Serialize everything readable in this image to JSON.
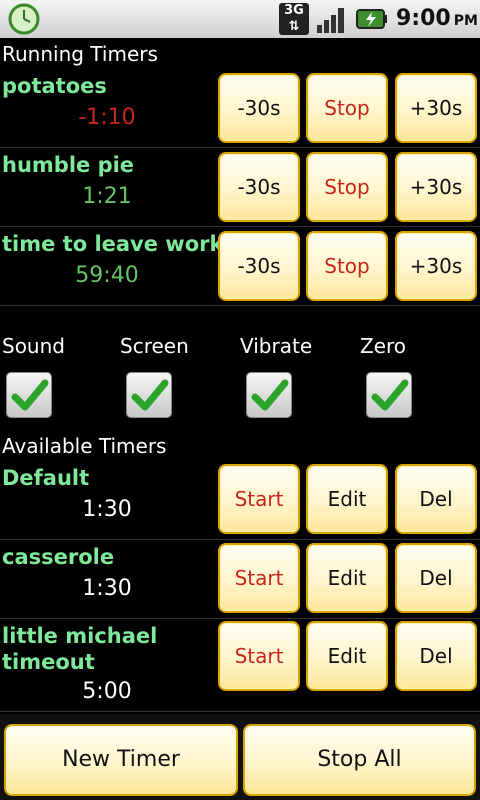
{
  "status_bar": {
    "network": "3G",
    "time": "9:00",
    "ampm": "PM"
  },
  "running": {
    "header": "Running Timers",
    "rows": [
      {
        "name": "potatoes",
        "time": "-1:10",
        "minus": "-30s",
        "stop": "Stop",
        "plus": "+30s"
      },
      {
        "name": "humble pie",
        "time": "1:21",
        "minus": "-30s",
        "stop": "Stop",
        "plus": "+30s"
      },
      {
        "name": "time to leave work",
        "time": "59:40",
        "minus": "-30s",
        "stop": "Stop",
        "plus": "+30s"
      }
    ]
  },
  "options": [
    {
      "label": "Sound",
      "checked": true
    },
    {
      "label": "Screen",
      "checked": true
    },
    {
      "label": "Vibrate",
      "checked": true
    },
    {
      "label": "Zero",
      "checked": true
    }
  ],
  "available": {
    "header": "Available Timers",
    "rows": [
      {
        "name": "Default",
        "time": "1:30",
        "start": "Start",
        "edit": "Edit",
        "del": "Del"
      },
      {
        "name": "casserole",
        "time": "1:30",
        "start": "Start",
        "edit": "Edit",
        "del": "Del"
      },
      {
        "name": "little michael timeout",
        "time": "5:00",
        "start": "Start",
        "edit": "Edit",
        "del": "Del"
      }
    ]
  },
  "footer": {
    "new_timer": "New Timer",
    "stop_all": "Stop All"
  },
  "colors": {
    "name_green": "#7fe89a",
    "time_red": "#c7251b",
    "time_green": "#66c266",
    "button_border": "#d9a300"
  }
}
